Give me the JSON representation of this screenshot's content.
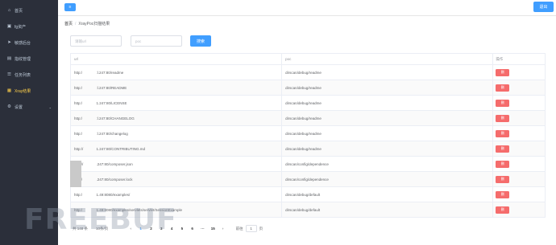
{
  "sidebar": {
    "items": [
      {
        "label": "首页",
        "icon": "home-icon",
        "glyph": "⌂",
        "active": false
      },
      {
        "label": "fg资产",
        "icon": "asset-icon",
        "glyph": "▣",
        "active": false
      },
      {
        "label": "敏感后台",
        "icon": "send-icon",
        "glyph": "➤",
        "active": false
      },
      {
        "label": "指纹管理",
        "icon": "fingerprint-icon",
        "glyph": "▤",
        "active": false
      },
      {
        "label": "任务列表",
        "icon": "task-list-icon",
        "glyph": "☰",
        "active": false
      },
      {
        "label": "Xray结果",
        "icon": "xray-icon",
        "glyph": "▦",
        "active": true
      },
      {
        "label": "设置",
        "icon": "settings-icon",
        "glyph": "⚙",
        "active": false
      }
    ],
    "submenu_caret": "⌄"
  },
  "topbar": {
    "collapse_glyph": "≡",
    "logout_label": "退出"
  },
  "breadcrumb": {
    "home": "首页",
    "separator": "/",
    "current": "XrayPoc扫描结果"
  },
  "filter": {
    "url_placeholder": "请输url",
    "poc_placeholder": "poc",
    "search_label": "搜索"
  },
  "table": {
    "columns": [
      "url",
      "poc",
      "操作"
    ],
    "delete_label": "删",
    "rows": [
      {
        "url": "http:/              :l.247:80/readme",
        "poc": "dirscan/debug/readme"
      },
      {
        "url": "http:/              :l.247:80/README",
        "poc": "dirscan/debug/readme"
      },
      {
        "url": "http:/              1.247:80/LICENSE",
        "poc": "dirscan/debug/readme"
      },
      {
        "url": "http:/              :l.247:80/CHANGELOG",
        "poc": "dirscan/debug/readme"
      },
      {
        "url": "http:/              :l.247:80/changelog",
        "poc": "dirscan/debug/readme"
      },
      {
        "url": "http://             1.247:80/CONTRIBUTING.md",
        "poc": "dirscan/debug/readme"
      },
      {
        "url": "http://             .247:80/composer.json",
        "poc": "dirscan/config/dependence"
      },
      {
        "url": "http:/              .247:80/composer.lock",
        "poc": "dirscan/config/dependence"
      },
      {
        "url": "http:/              1.49:8080/examples/",
        "poc": "dirscan/debug/default"
      },
      {
        "url": "http:/              1.49:8080/examples/servlets/servlet/SessionExample",
        "poc": "dirscan/debug/default"
      }
    ]
  },
  "pagination": {
    "total": "共 148 条",
    "page_size": "10条/页",
    "prev": "‹",
    "pages": [
      "1",
      "2",
      "3",
      "4",
      "5",
      "6",
      "···",
      "15"
    ],
    "active_page": "1",
    "next": "›",
    "goto_prefix": "前往",
    "goto_value": "1",
    "goto_suffix": "页"
  },
  "watermark": "FREEBUF",
  "colors": {
    "sidebar_bg": "#2b2f3a",
    "sidebar_active": "#ffd04b",
    "primary": "#409eff",
    "danger": "#f56c6c"
  }
}
